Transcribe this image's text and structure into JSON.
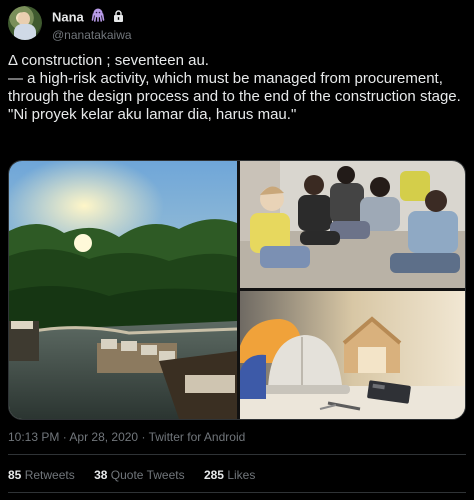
{
  "user": {
    "display_name": "Nana",
    "handle": "@nanatakaiwa",
    "badges": [
      "octopus-emoji",
      "lock-icon"
    ]
  },
  "tweet": {
    "lines": [
      "Δ construction ; seventeen au.",
      "— a high-risk activity, which must be managed from procurement, through the design process and to the end of the construction stage.",
      "\"Ni proyek kelar aku lamar dia, harus mau.\""
    ],
    "media": [
      {
        "name": "infinity-pool-jungle-photo"
      },
      {
        "name": "group-sitting-photo"
      },
      {
        "name": "construction-hardhat-photo"
      }
    ]
  },
  "meta": {
    "time": "10:13 PM",
    "date": "Apr 28, 2020",
    "sep": "·",
    "source": "Twitter for Android"
  },
  "stats": {
    "retweets_count": "85",
    "retweets_label": "Retweets",
    "quotes_count": "38",
    "quotes_label": "Quote Tweets",
    "likes_count": "285",
    "likes_label": "Likes"
  },
  "colors": {
    "background": "#000000",
    "text": "#e7e9ea",
    "muted": "#71767b",
    "border": "#2f3336"
  }
}
